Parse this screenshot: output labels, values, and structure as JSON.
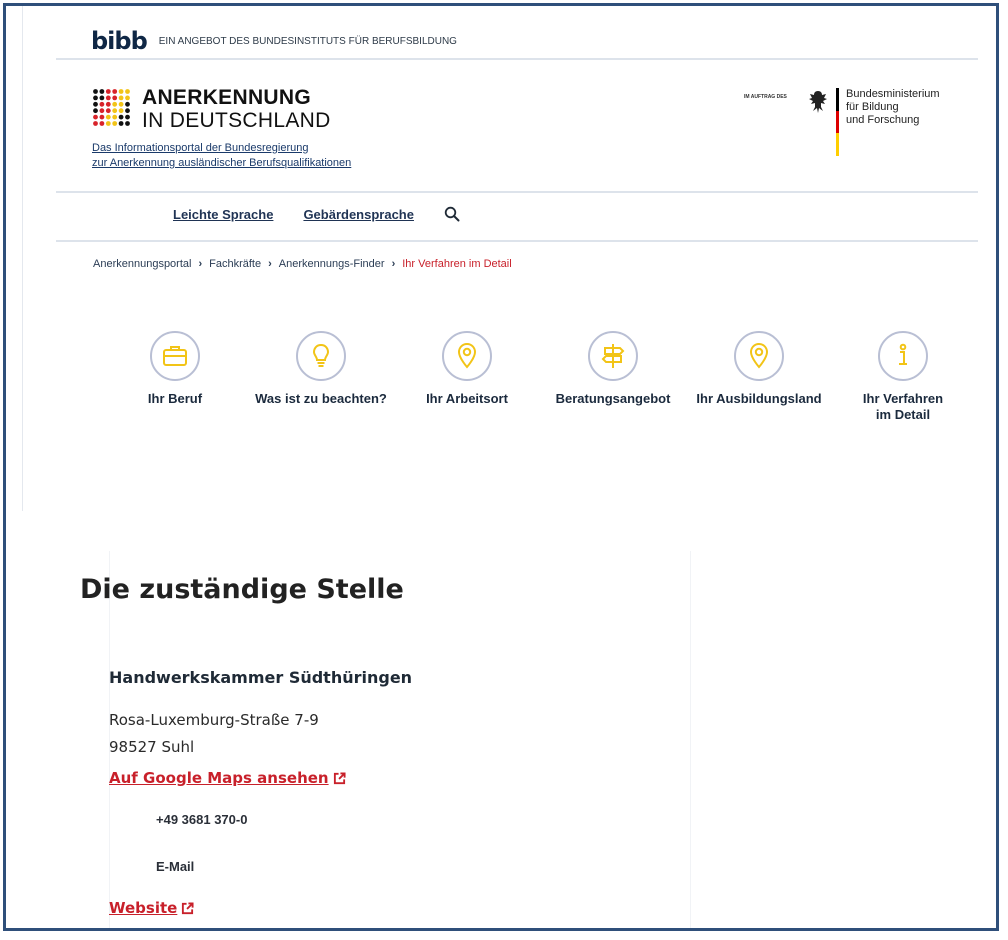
{
  "topbar": {
    "logo_text": "bibb",
    "tagline": "EIN ANGEBOT DES BUNDESINSTITUTS FÜR BERUFSBILDUNG"
  },
  "brand": {
    "title": "ANERKENNUNG",
    "subtitle": "IN DEUTSCHLAND",
    "description_line1": "Das Informationsportal der Bundesregierung",
    "description_line2": "zur Anerkennung ausländischer Berufsqualifikationen"
  },
  "ministry": {
    "prefix": "IM AUFTRAG DES",
    "name_line1": "Bundesministerium",
    "name_line2": "für Bildung",
    "name_line3": "und Forschung",
    "stripe_colors": [
      "#000000",
      "#dd0000",
      "#ffce00"
    ]
  },
  "nav": {
    "items": [
      {
        "label": "Leichte Sprache"
      },
      {
        "label": "Gebärdensprache"
      }
    ],
    "search_icon": "search-icon"
  },
  "breadcrumb": {
    "items": [
      {
        "label": "Anerkennungsportal"
      },
      {
        "label": "Fachkräfte"
      },
      {
        "label": "Anerkennungs-Finder"
      }
    ],
    "current": "Ihr Verfahren im Detail"
  },
  "steps": [
    {
      "label": "Ihr Beruf",
      "icon": "briefcase-icon"
    },
    {
      "label": "Was ist zu beachten?",
      "icon": "lightbulb-icon"
    },
    {
      "label": "Ihr Arbeitsort",
      "icon": "location-pin-icon"
    },
    {
      "label": "Beratungsangebot",
      "icon": "signpost-icon"
    },
    {
      "label": "Ihr Ausbildungsland",
      "icon": "location-pin-icon"
    },
    {
      "label": "Ihr Verfahren\nim Detail",
      "label_line1": "Ihr Verfahren",
      "label_line2": "im Detail",
      "icon": "info-icon"
    }
  ],
  "section": {
    "title": "Die zuständige Stelle",
    "organization": "Handwerkskammer Südthüringen",
    "street": "Rosa-Luxemburg-Straße 7-9",
    "city": "98527 Suhl",
    "maps_link": "Auf Google Maps ansehen",
    "phone": "+49 3681 370-0",
    "email": "E-Mail",
    "website_link": "Website"
  },
  "colors": {
    "accent_red": "#c8202a",
    "icon_yellow": "#f2c417",
    "navy": "#1f3354",
    "circle_border": "#b9bfd4"
  }
}
